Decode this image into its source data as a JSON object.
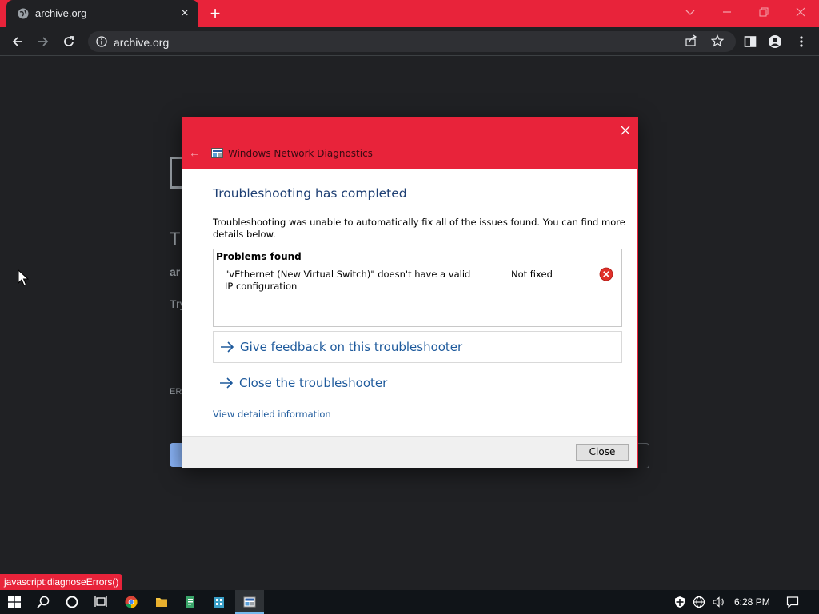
{
  "browser": {
    "tab_title": "archive.org",
    "address": "archive.org",
    "status_url": "javascript:diagnoseErrors()"
  },
  "page_fragments": {
    "title_fragment": "T",
    "domain_fragment": "ar",
    "try_fragment": "Try",
    "error_fragment": "ERI"
  },
  "dialog": {
    "title": "Windows Network Diagnostics",
    "heading": "Troubleshooting has completed",
    "description": "Troubleshooting was unable to automatically fix all of the issues found. You can find more details below.",
    "problems_header": "Problems found",
    "problems": [
      {
        "text": "\"vEthernet (New Virtual Switch)\" doesn't have a valid IP configuration",
        "status": "Not fixed"
      }
    ],
    "link_feedback": "Give feedback on this troubleshooter",
    "link_close": "Close the troubleshooter",
    "detail_link": "View detailed information",
    "close_button": "Close"
  },
  "taskbar": {
    "clock": "6:28 PM"
  },
  "colors": {
    "accent_red": "#e8233a",
    "link_blue": "#1e5a9c",
    "heading_blue": "#1e3f73",
    "page_bg": "#202124"
  }
}
